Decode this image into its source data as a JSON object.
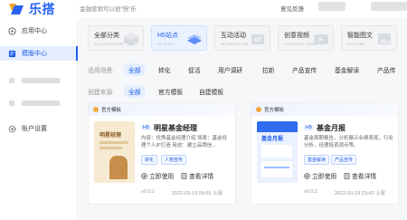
{
  "app": {
    "name": "乐搭",
    "slogan": "金融营销可以很“快”乐"
  },
  "header": {
    "feedback": "意见反馈"
  },
  "sidebar": {
    "items": [
      {
        "label": "应用中心",
        "icon": "app-grid-icon"
      },
      {
        "label": "模版中心",
        "icon": "template-icon",
        "active": true
      },
      {
        "label": "账户设置",
        "icon": "gear-icon"
      }
    ]
  },
  "categories": [
    {
      "title": "全部分类",
      "sub": "ALL CATEGORY"
    },
    {
      "title": "H5站点",
      "sub": "H5 SITE",
      "active": true
    },
    {
      "title": "互动活动",
      "sub": "INTERACTION"
    },
    {
      "title": "创意视频",
      "sub": "CREATIVE VIDEO"
    },
    {
      "title": "智能图文",
      "sub": "PICTURE"
    }
  ],
  "filters": {
    "scene_label": "适用场景:",
    "scene_options": [
      "全部",
      "转化",
      "促活",
      "用户调研",
      "拉新",
      "产品宣传",
      "基金解读",
      "产品传"
    ],
    "source_label": "创建来源:",
    "source_options": [
      "全部",
      "官方模板",
      "自建模板"
    ]
  },
  "cards": [
    {
      "head": "官方模板",
      "badge": "H5",
      "title": "明星基金经理",
      "desc": "内容：优秀基金经理介绍 场景：基金经理个人IP打造 用途：建立品牌信...",
      "tags": [
        "转化",
        "人物宣传"
      ],
      "use": "立即使用",
      "detail": "查看详情",
      "version": "v0.0.1",
      "date": "2022-03-19 00:09 上架",
      "thumb_title": "明星经理"
    },
    {
      "head": "官方模板",
      "badge": "H5",
      "title": "基金月报",
      "desc": "基金周期报告，分析展示业绩表现，行业分析，经理投资观点等。",
      "tags": [
        "基金解读",
        "产品宣传"
      ],
      "use": "立即使用",
      "detail": "查看详情",
      "version": "v0.0.2",
      "date": "2022-03-18 23:43 上架",
      "thumb_title": "基金月报"
    }
  ],
  "colors": {
    "accent": "#1f5ee8",
    "logo_orange": "#f5a623",
    "logo_blue": "#2762f5"
  }
}
